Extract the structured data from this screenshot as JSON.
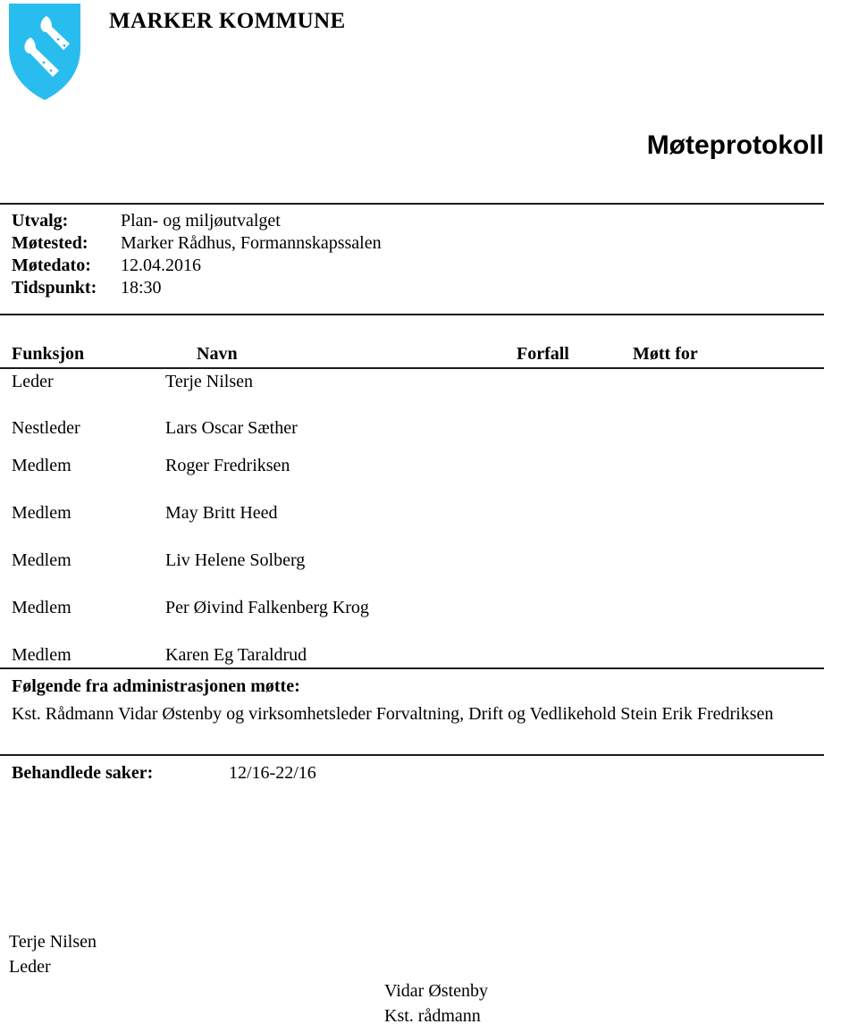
{
  "header": {
    "org_name": "MARKER KOMMUNE",
    "coat_of_arms_icon": "marker-kommune-coat-of-arms-icon",
    "shield_color": "#29BDEF",
    "charge_color": "#FFFFFF"
  },
  "document": {
    "title": "Møteprotokoll"
  },
  "meta": {
    "rows": [
      {
        "label": "Utvalg:",
        "value": "Plan- og miljøutvalget"
      },
      {
        "label": "Møtested:",
        "value": "Marker Rådhus, Formannskapssalen"
      },
      {
        "label": "Møtedato:",
        "value": "12.04.2016"
      },
      {
        "label": "Tidspunkt:",
        "value": "18:30"
      }
    ]
  },
  "participants": {
    "columns": {
      "funksjon": "Funksjon",
      "navn": "Navn",
      "forfall": "Forfall",
      "mott_for": "Møtt for"
    },
    "rows": [
      {
        "funksjon": "Leder",
        "navn": "Terje Nilsen",
        "forfall": "",
        "mott_for": ""
      },
      {
        "funksjon": "Nestleder",
        "navn": "Lars Oscar Sæther",
        "forfall": "",
        "mott_for": ""
      },
      {
        "funksjon": "Medlem",
        "navn": "Roger Fredriksen",
        "forfall": "",
        "mott_for": ""
      },
      {
        "funksjon": "Medlem",
        "navn": "May Britt Heed",
        "forfall": "",
        "mott_for": ""
      },
      {
        "funksjon": "Medlem",
        "navn": "Liv Helene Solberg",
        "forfall": "",
        "mott_for": ""
      },
      {
        "funksjon": "Medlem",
        "navn": "Per Øivind Falkenberg Krog",
        "forfall": "",
        "mott_for": ""
      },
      {
        "funksjon": "Medlem",
        "navn": "Karen Eg Taraldrud",
        "forfall": "",
        "mott_for": ""
      }
    ]
  },
  "administration": {
    "heading": "Følgende fra administrasjonen møtte:",
    "text": "Kst. Rådmann Vidar Østenby og virksomhetsleder Forvaltning, Drift og Vedlikehold Stein Erik Fredriksen"
  },
  "cases": {
    "label": "Behandlede saker:",
    "value": "12/16-22/16"
  },
  "signatures": {
    "left": {
      "name": "Terje Nilsen",
      "role": "Leder"
    },
    "right": {
      "name": "Vidar Østenby",
      "role": "Kst. rådmann"
    }
  }
}
